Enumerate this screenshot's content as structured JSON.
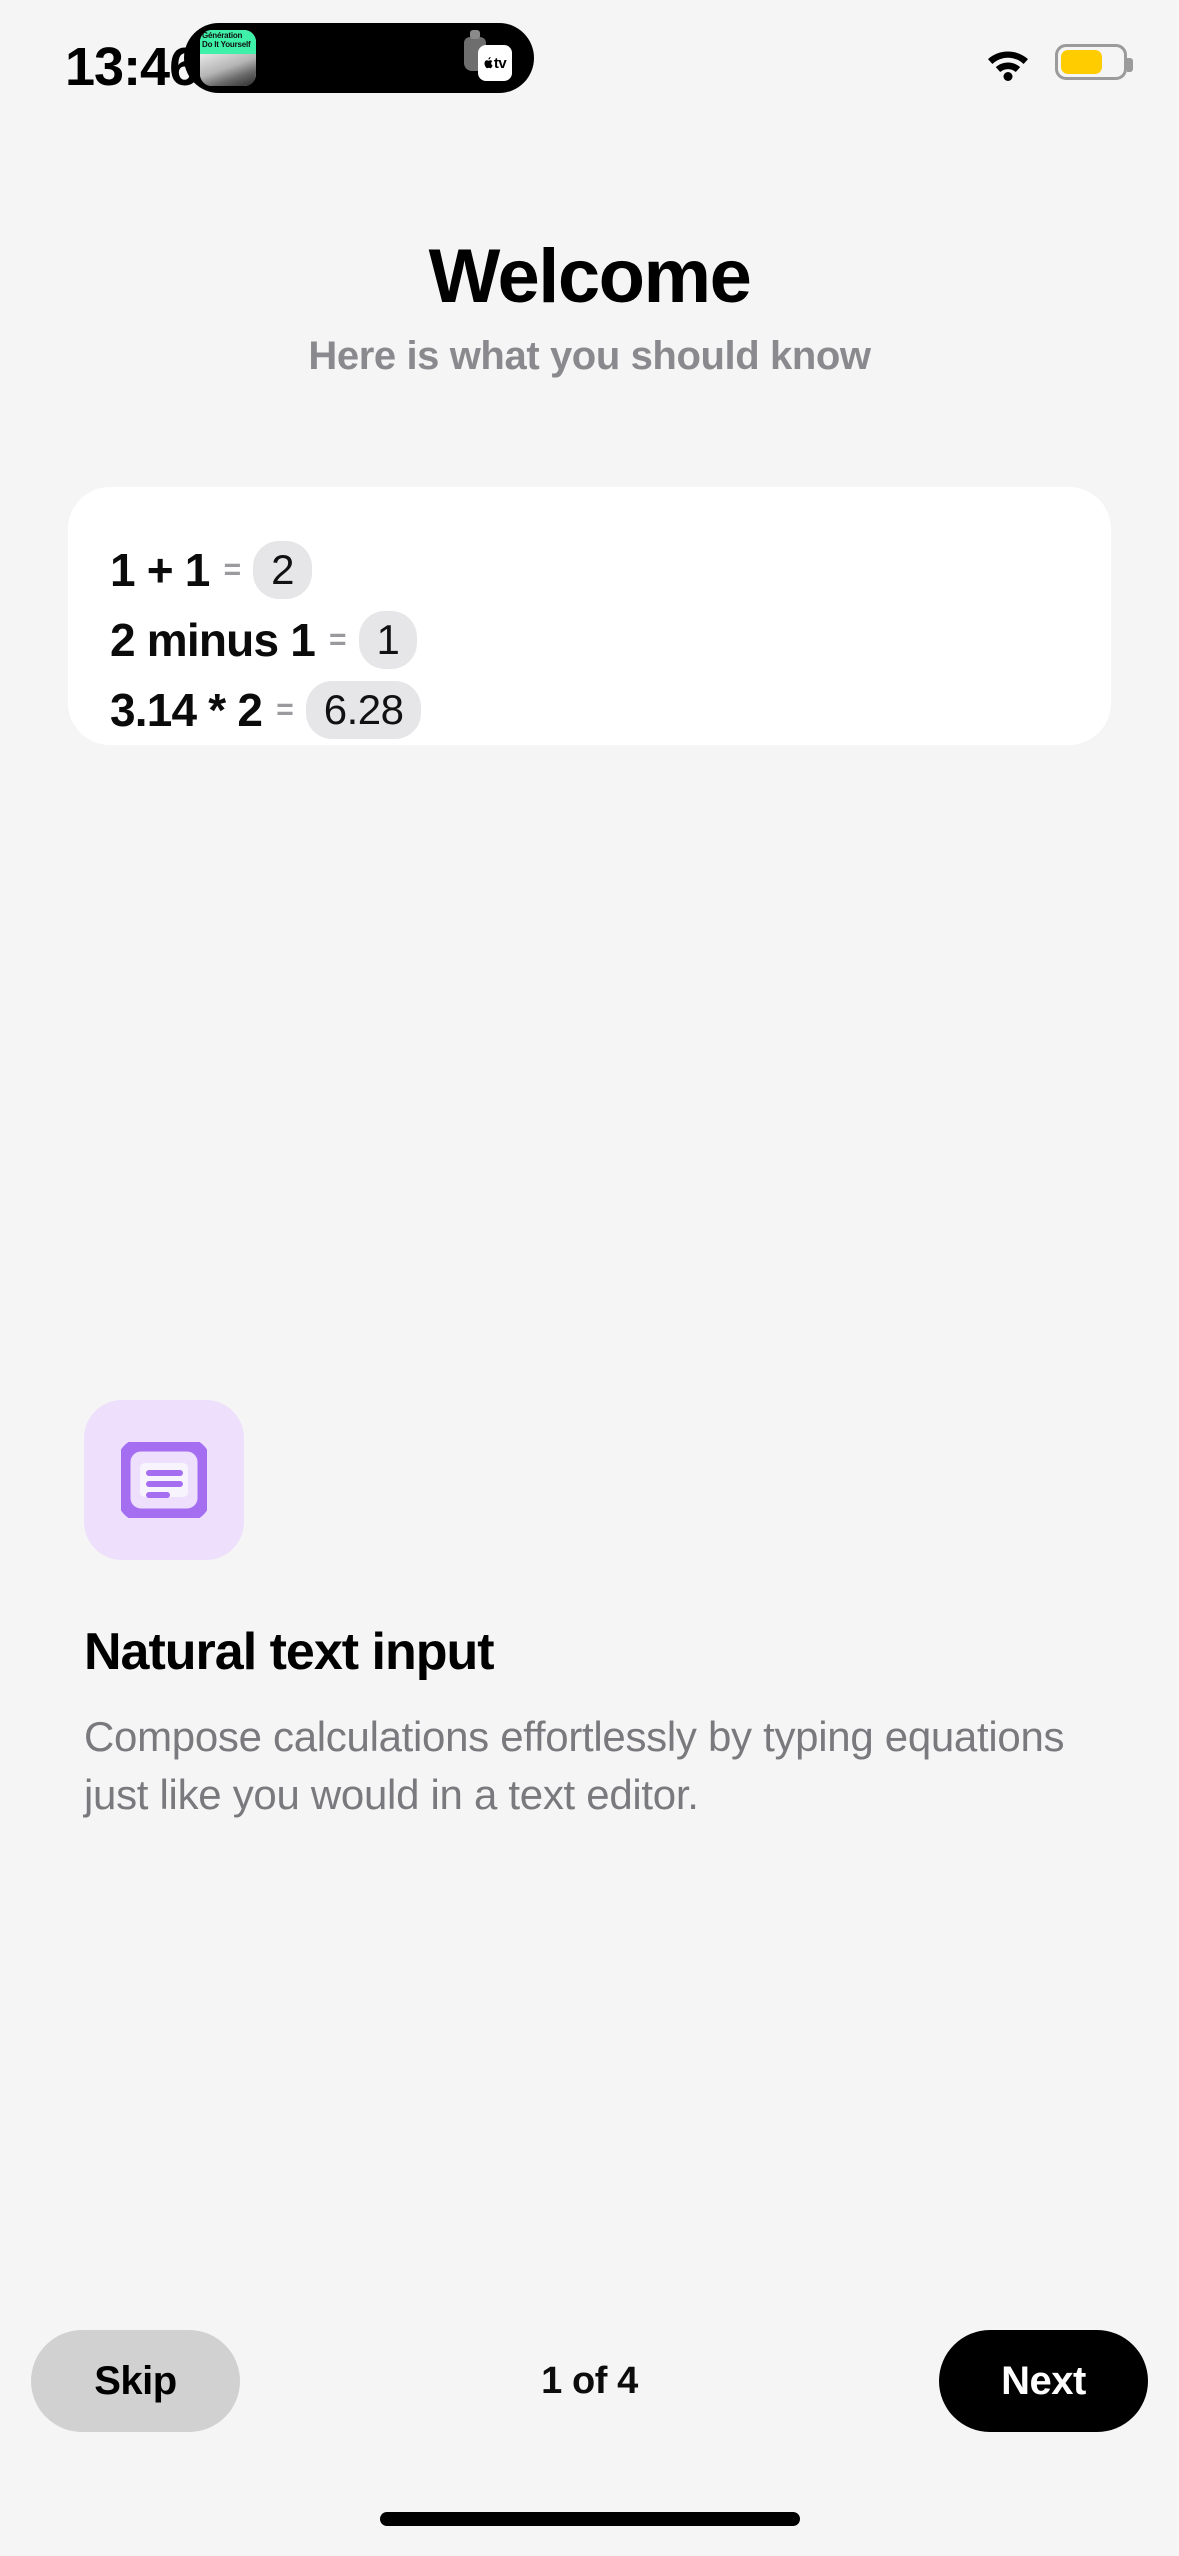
{
  "status_bar": {
    "time": "13:46",
    "dynamic_island": {
      "activity_title": "Génération Do It Yourself",
      "app_badge_label": "tv",
      "thumbnail_icon": "podcast-artwork"
    },
    "wifi_icon": "wifi-icon",
    "battery": {
      "icon": "battery-icon",
      "level_percent": 65,
      "fill_color": "#ffcc00",
      "low_power_mode": true
    }
  },
  "header": {
    "title": "Welcome",
    "subtitle": "Here is what you should know"
  },
  "equation_card": {
    "rows": [
      {
        "expression": "1 + 1",
        "equals": "=",
        "result": "2"
      },
      {
        "expression": "2 minus 1",
        "equals": "=",
        "result": "1"
      },
      {
        "expression": "3.14 * 2",
        "equals": "=",
        "result": "6.28"
      }
    ]
  },
  "feature": {
    "icon": "text-document-icon",
    "icon_color": "#a56ef0",
    "icon_background": "#eee0fc",
    "title": "Natural text input",
    "description": "Compose calculations effortlessly by typing equations just like you would in a text editor."
  },
  "bottom_bar": {
    "skip_label": "Skip",
    "page_counter": "1 of 4",
    "next_label": "Next"
  },
  "colors": {
    "background": "#f5f5f5",
    "card": "#ffffff",
    "accent_purple": "#a56ef0",
    "muted_text": "#8a8a8e",
    "pill_background": "#e6e6e8"
  }
}
